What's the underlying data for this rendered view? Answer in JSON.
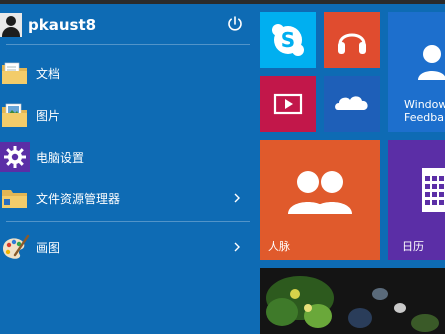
{
  "user": {
    "name": "pkaust8"
  },
  "menu": {
    "items": [
      {
        "label": "文档",
        "icon": "folder-documents-icon"
      },
      {
        "label": "图片",
        "icon": "folder-pictures-icon"
      },
      {
        "label": "电脑设置",
        "icon": "gear-icon"
      },
      {
        "label": "文件资源管理器",
        "icon": "file-explorer-icon",
        "has_submenu": true
      },
      {
        "label": "画图",
        "icon": "paint-palette-icon",
        "has_submenu": true
      }
    ]
  },
  "tiles": {
    "skype": {
      "icon": "skype-icon",
      "color": "#00aff0"
    },
    "music": {
      "icon": "headphones-icon",
      "color": "#e04c2f"
    },
    "video": {
      "icon": "video-icon",
      "color": "#c2174a"
    },
    "onedrive": {
      "icon": "cloud-icon",
      "color": "#1e5fb8"
    },
    "feedback": {
      "label_line1": "Window",
      "label_line2": "Feedba",
      "icon": "user-feedback-icon",
      "color": "#1d6fcd"
    },
    "people": {
      "label": "人脉",
      "icon": "people-icon",
      "color": "#e05a2c"
    },
    "calendar": {
      "label": "日历",
      "icon": "calendar-icon",
      "color": "#5b2ea6"
    },
    "photo": {
      "icon": "photo-tile-icon"
    }
  },
  "colors": {
    "background": "#0e6bb4",
    "topbar": "#2b2b2b"
  }
}
